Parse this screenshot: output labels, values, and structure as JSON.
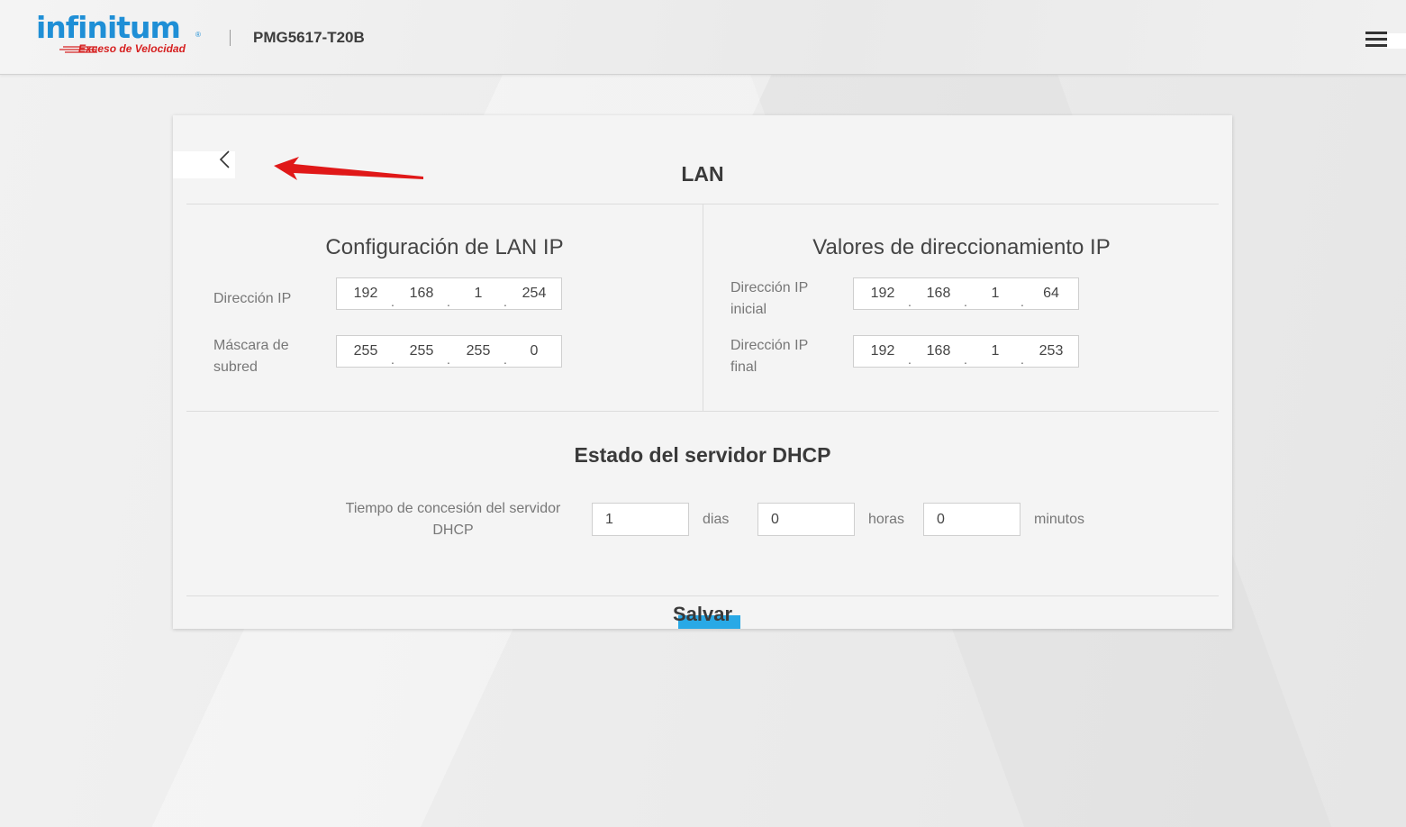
{
  "header": {
    "logo_text": "infinitum",
    "logo_registered": "®",
    "logo_tagline": "Exceso de Velocidad",
    "model": "PMG5617-T20B",
    "menu_icon": "hamburger-menu-icon"
  },
  "page": {
    "title": "LAN",
    "back_icon": "chevron-left-icon"
  },
  "lan_ip": {
    "title": "Configuración de LAN IP",
    "ip_label": "Dirección IP",
    "ip": [
      "192",
      "168",
      "1",
      "254"
    ],
    "mask_label": "Máscara de subred",
    "mask": [
      "255",
      "255",
      "255",
      "0"
    ]
  },
  "addressing": {
    "title": "Valores de direccionamiento IP",
    "start_label": "Dirección IP inicial",
    "start_ip": [
      "192",
      "168",
      "1",
      "64"
    ],
    "end_label": "Dirección IP final",
    "end_ip": [
      "192",
      "168",
      "1",
      "253"
    ]
  },
  "dhcp": {
    "title": "Estado del servidor DHCP",
    "lease_label": "Tiempo de concesión del servidor DHCP",
    "days_value": "1",
    "days_unit": "dias",
    "hours_value": "0",
    "hours_unit": "horas",
    "minutes_value": "0",
    "minutes_unit": "minutos"
  },
  "actions": {
    "save_label": "Salvar"
  },
  "colors": {
    "brand_blue": "#1f8fd6",
    "brand_red": "#d62121",
    "save_accent": "#29a9e6",
    "annotation_arrow": "#e01818"
  }
}
